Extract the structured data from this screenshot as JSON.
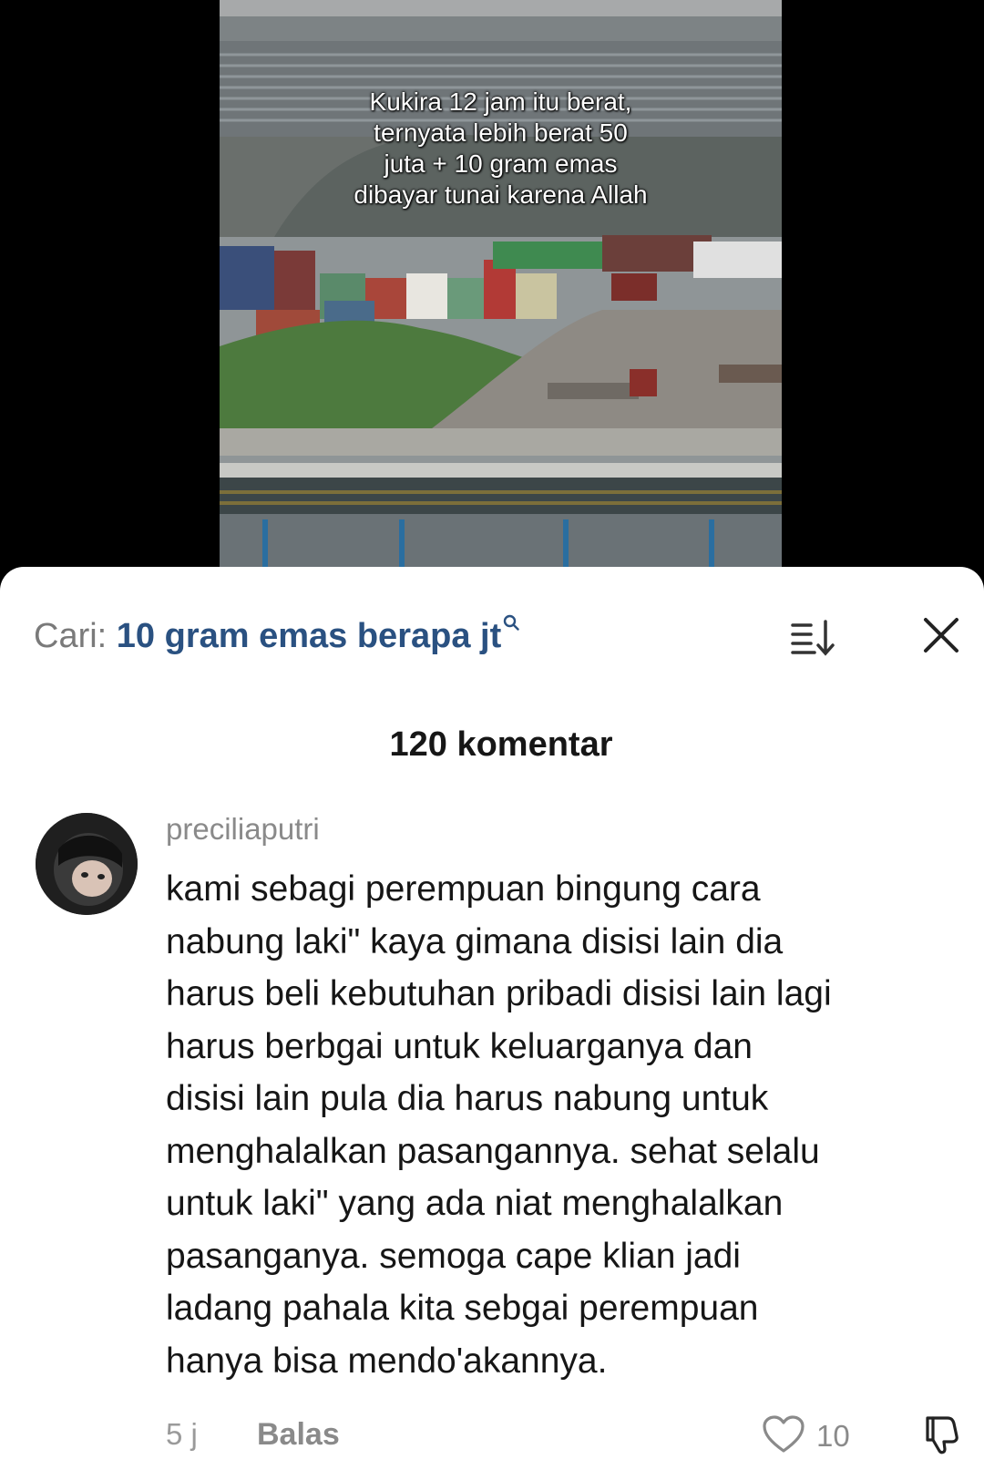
{
  "video": {
    "overlay_lines": [
      "Kukira 12 jam itu berat,",
      "ternyata lebih berat 50",
      "juta + 10 gram emas",
      "dibayar tunai karena Allah"
    ]
  },
  "search": {
    "prefix": "Cari: ",
    "query": "10 gram emas berapa jt",
    "search_icon": "search-icon"
  },
  "toolbar": {
    "sort_icon": "sort-icon",
    "close_icon": "close-icon"
  },
  "comments_header": {
    "count_label": "120 komentar"
  },
  "comment": {
    "username": "preciliaputri",
    "lines": [
      "kami sebagi perempuan bingung cara",
      "nabung laki\" kaya gimana disisi lain dia",
      "harus beli kebutuhan pribadi disisi lain lagi",
      "harus berbgai untuk keluarganya dan",
      "disisi lain pula dia harus nabung untuk",
      "menghalalkan pasangannya. sehat selalu",
      "untuk laki\" yang ada niat menghalalkan",
      "pasanganya. semoga cape klian jadi",
      "ladang pahala kita sebgai perempuan",
      "hanya bisa mendo'akannya."
    ],
    "time": "5 j",
    "reply_label": "Balas",
    "like_count": "10",
    "like_icon": "heart-icon",
    "dislike_icon": "dislike-icon"
  },
  "colors": {
    "query": "#2a5181",
    "muted": "#8a8a8a",
    "text": "#161616",
    "sheet_bg": "#ffffff"
  }
}
